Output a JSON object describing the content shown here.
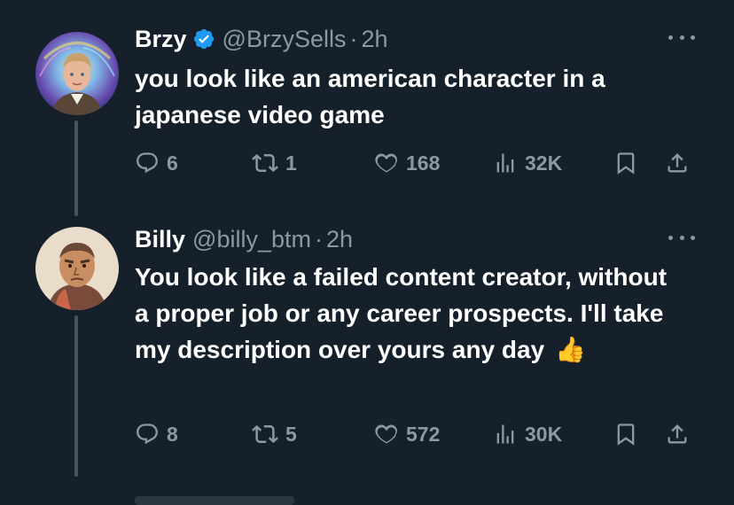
{
  "colors": {
    "background": "#15202b",
    "primary_text": "#ffffff",
    "secondary_text": "#8b98a5",
    "verified": "#1d9bf0",
    "thread_line": "#425466"
  },
  "tweets": [
    {
      "name": "Brzy",
      "verified": true,
      "handle": "@BrzySells",
      "separator": "·",
      "time": "2h",
      "text": "you look like an american character in a japanese video game",
      "replies": "6",
      "retweets": "1",
      "likes": "168",
      "views": "32K",
      "icons": [
        "reply-icon",
        "retweet-icon",
        "like-icon",
        "views-icon",
        "bookmark-icon",
        "share-icon"
      ]
    },
    {
      "name": "Billy",
      "verified": false,
      "handle": "@billy_btm",
      "separator": "·",
      "time": "2h",
      "text": "You look like a failed content creator, without a proper job or any career prospects. I'll take my description over yours any day",
      "emoji": "👍",
      "replies": "8",
      "retweets": "5",
      "likes": "572",
      "views": "30K",
      "icons": [
        "reply-icon",
        "retweet-icon",
        "like-icon",
        "views-icon",
        "bookmark-icon",
        "share-icon"
      ]
    }
  ]
}
